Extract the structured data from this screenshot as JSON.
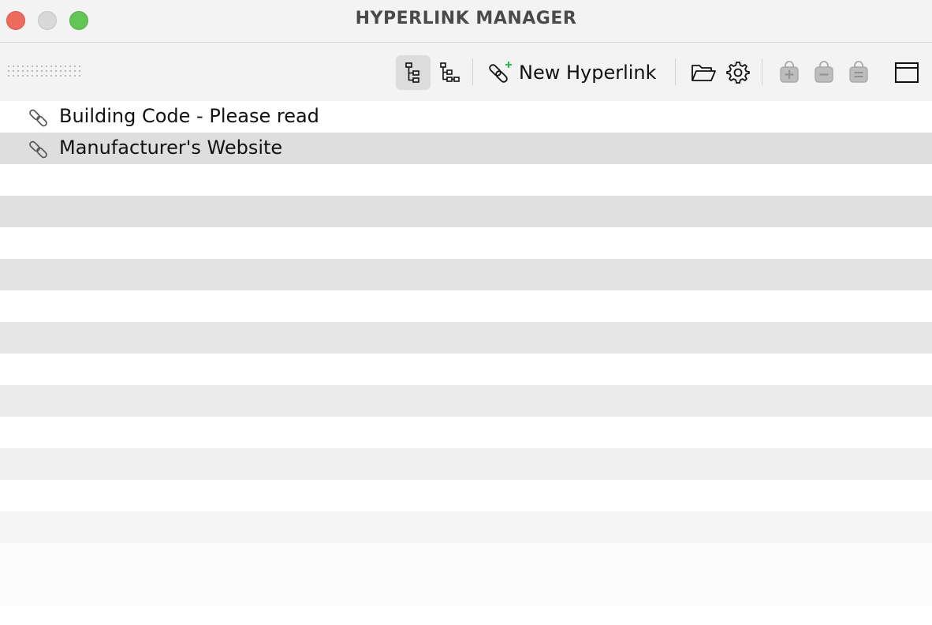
{
  "window": {
    "title": "HYPERLINK MANAGER",
    "traffic_lights": [
      "close",
      "minimize",
      "zoom"
    ]
  },
  "toolbar": {
    "buttons": [
      {
        "name": "tree-view",
        "icon": "tree-view-icon",
        "active": true
      },
      {
        "name": "flat-tree-view",
        "icon": "tree-branch-icon",
        "active": false
      },
      {
        "name": "new-hyperlink",
        "icon": "chain-link-plus-icon",
        "label": "New Hyperlink"
      },
      {
        "name": "open-folder",
        "icon": "folder-open-icon"
      },
      {
        "name": "settings",
        "icon": "gear-icon"
      },
      {
        "name": "add-to-bag",
        "icon": "bag-plus-icon",
        "enabled": false
      },
      {
        "name": "remove-from-bag",
        "icon": "bag-minus-icon",
        "enabled": false
      },
      {
        "name": "bag-list",
        "icon": "bag-equal-icon",
        "enabled": false
      },
      {
        "name": "window-panel",
        "icon": "window-icon"
      }
    ],
    "new_hyperlink_label": "New Hyperlink"
  },
  "links": [
    {
      "label": "Building Code - Please read",
      "icon": "chain-link-icon"
    },
    {
      "label": "Manufacturer's Website",
      "icon": "chain-link-icon"
    }
  ],
  "colors": {
    "toolbar_bg": "#f3f3f3",
    "accent_plus": "#2db84a",
    "disabled_icon": "#a9a9a9"
  }
}
